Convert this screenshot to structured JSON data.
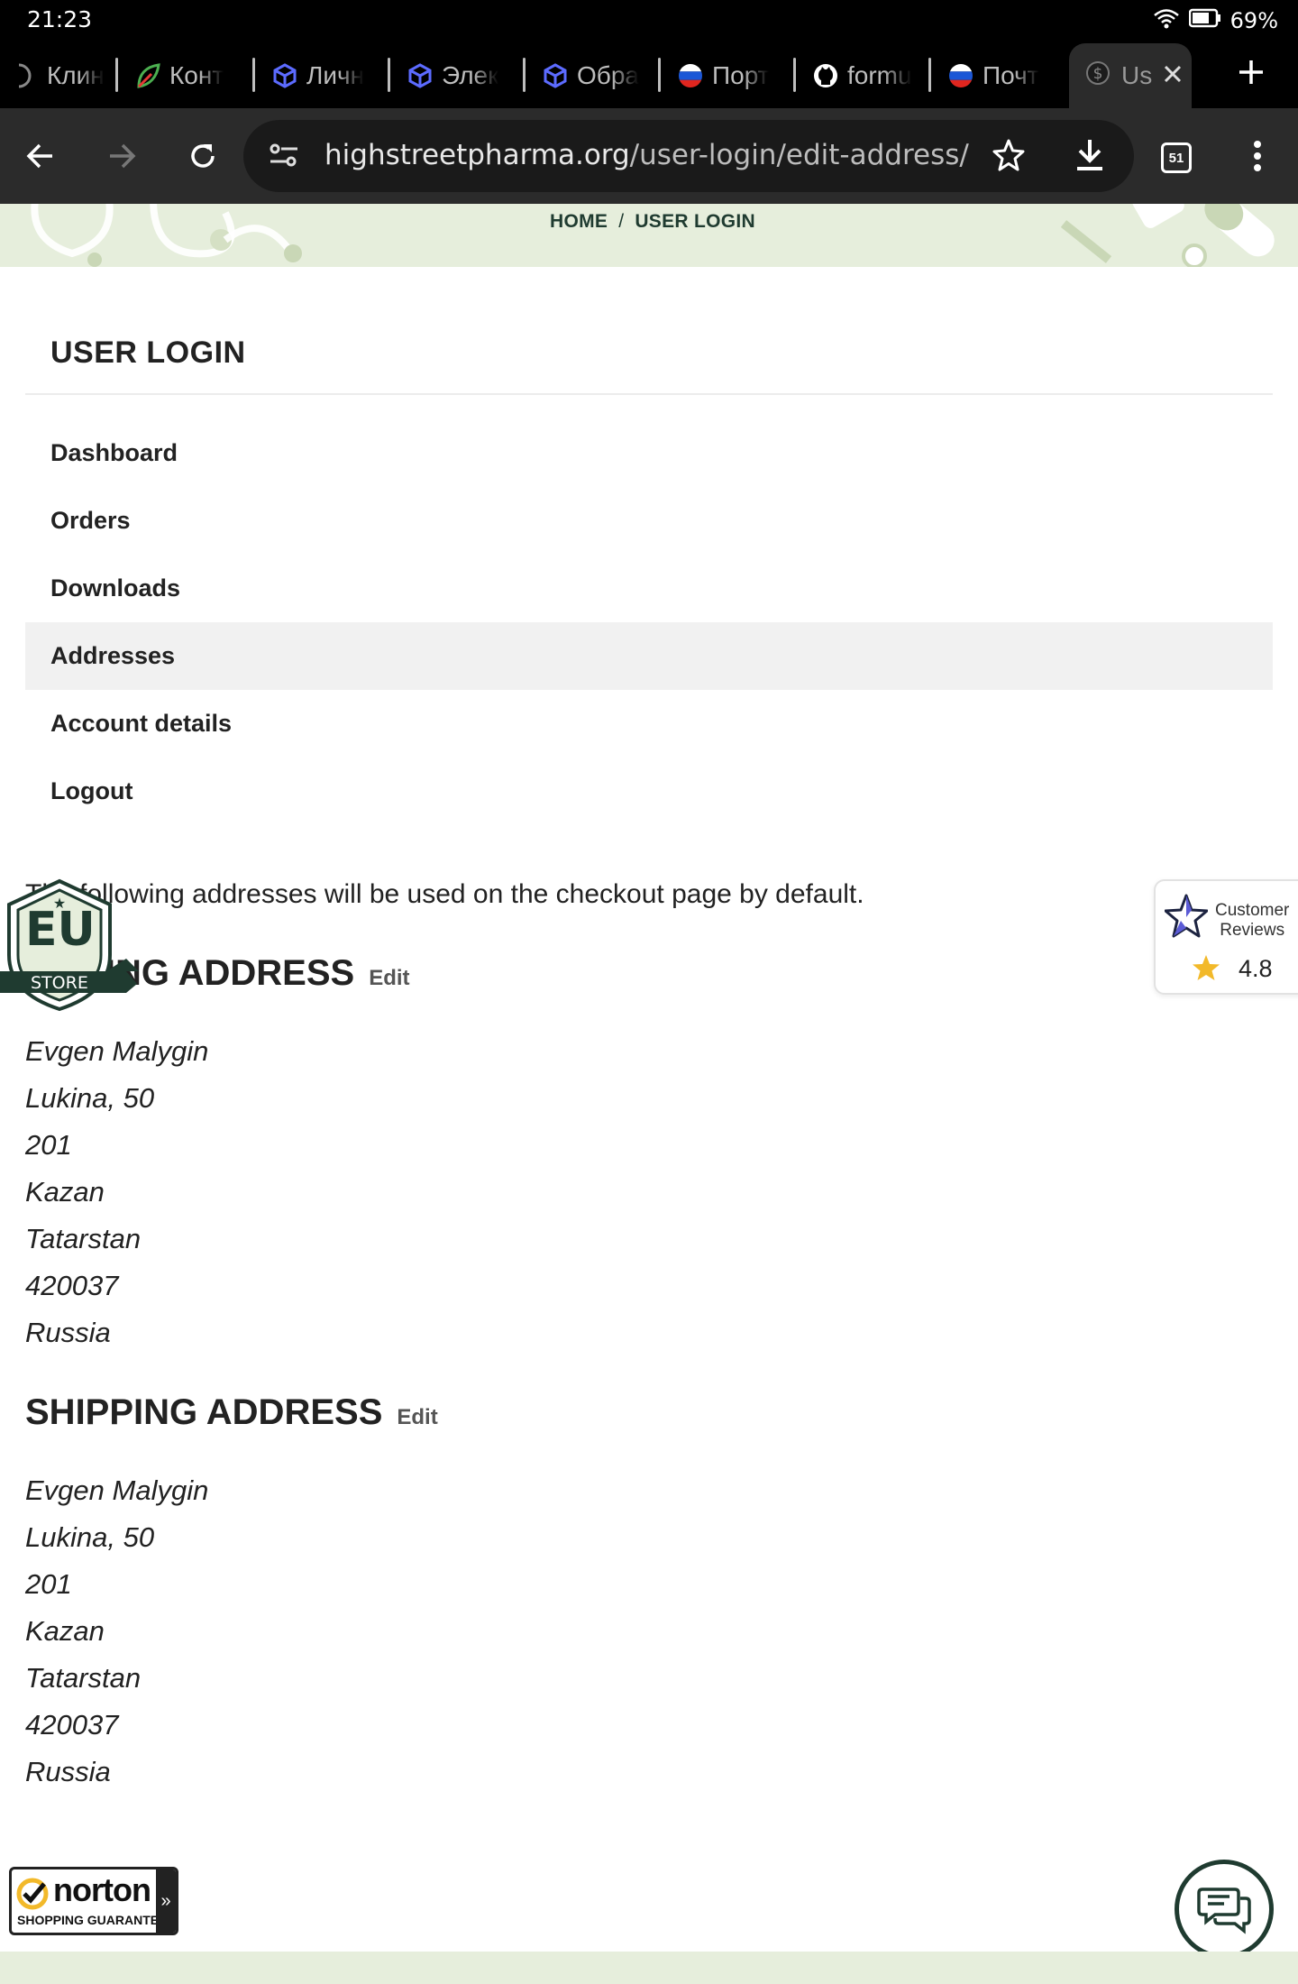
{
  "status_bar": {
    "time": "21:23",
    "battery": "69%"
  },
  "browser": {
    "tabs": [
      {
        "label": "Клин",
        "icon": "generic-site-icon"
      },
      {
        "label": "Конт",
        "icon": "leaf-icon"
      },
      {
        "label": "Личн",
        "icon": "cube-icon"
      },
      {
        "label": "Элек",
        "icon": "cube-icon"
      },
      {
        "label": "Обра",
        "icon": "cube-icon"
      },
      {
        "label": "Порт",
        "icon": "russia-flag-icon"
      },
      {
        "label": "formu",
        "icon": "github-icon"
      },
      {
        "label": "Почт",
        "icon": "russia-flag-icon"
      }
    ],
    "active_tab": {
      "label": "Us",
      "icon": "dollar-icon"
    },
    "url_host": "highstreetpharma.org",
    "url_path": "/user-login/edit-address/",
    "tab_count": "51"
  },
  "breadcrumb": {
    "home": "HOME",
    "separator": "/",
    "current": "USER LOGIN"
  },
  "page": {
    "title": "USER LOGIN",
    "nav": [
      {
        "label": "Dashboard",
        "active": false
      },
      {
        "label": "Orders",
        "active": false
      },
      {
        "label": "Downloads",
        "active": false
      },
      {
        "label": "Addresses",
        "active": true
      },
      {
        "label": "Account details",
        "active": false
      },
      {
        "label": "Logout",
        "active": false
      }
    ],
    "intro": "The following addresses will be used on the checkout page by default.",
    "billing": {
      "heading": "BILLING ADDRESS",
      "edit_label": "Edit",
      "lines": [
        "Evgen Malygin",
        "Lukina, 50",
        "201",
        "Kazan",
        "Tatarstan",
        "420037",
        "Russia"
      ]
    },
    "shipping": {
      "heading": "SHIPPING ADDRESS",
      "edit_label": "Edit",
      "lines": [
        "Evgen Malygin",
        "Lukina, 50",
        "201",
        "Kazan",
        "Tatarstan",
        "420037",
        "Russia"
      ]
    }
  },
  "badges": {
    "eu": {
      "main": "EU",
      "sub": "STORE"
    },
    "reviews": {
      "label_1": "Customer",
      "label_2": "Reviews",
      "score": "4.8"
    },
    "norton": {
      "name": "norton",
      "sub": "SHOPPING GUARANTEE"
    }
  },
  "colors": {
    "brand_dark": "#1f3b30",
    "banner_bg": "#e6eedc",
    "active_nav_bg": "#f1f1f1",
    "star": "#f2b92a"
  }
}
